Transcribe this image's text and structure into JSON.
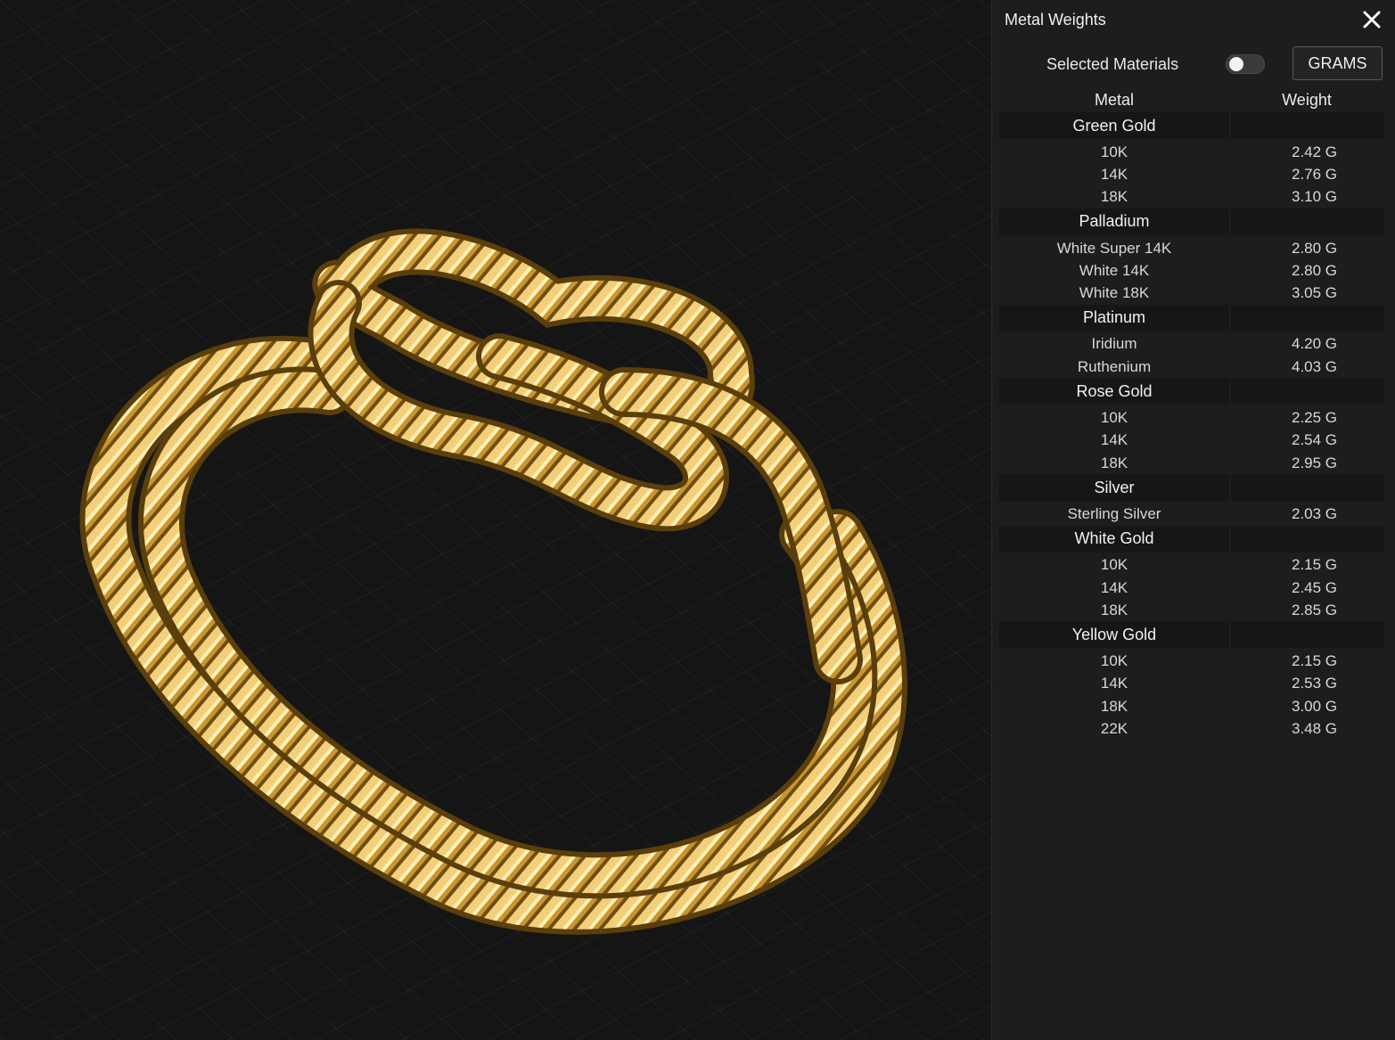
{
  "panel": {
    "title": "Metal Weights",
    "selected_materials_label": "Selected Materials",
    "selected_materials_on": false,
    "unit_button": "GRAMS",
    "columns": {
      "metal": "Metal",
      "weight": "Weight"
    },
    "groups": [
      {
        "name": "Green Gold",
        "items": [
          {
            "name": "10K",
            "weight": "2.42 G"
          },
          {
            "name": "14K",
            "weight": "2.76 G"
          },
          {
            "name": "18K",
            "weight": "3.10 G"
          }
        ]
      },
      {
        "name": "Palladium",
        "items": [
          {
            "name": "White Super 14K",
            "weight": "2.80 G"
          },
          {
            "name": "White 14K",
            "weight": "2.80 G"
          },
          {
            "name": "White 18K",
            "weight": "3.05 G"
          }
        ]
      },
      {
        "name": "Platinum",
        "items": [
          {
            "name": "Iridium",
            "weight": "4.20 G"
          },
          {
            "name": "Ruthenium",
            "weight": "4.03 G"
          }
        ]
      },
      {
        "name": "Rose Gold",
        "items": [
          {
            "name": "10K",
            "weight": "2.25 G"
          },
          {
            "name": "14K",
            "weight": "2.54 G"
          },
          {
            "name": "18K",
            "weight": "2.95 G"
          }
        ]
      },
      {
        "name": "Silver",
        "items": [
          {
            "name": "Sterling Silver",
            "weight": "2.03 G"
          }
        ]
      },
      {
        "name": "White Gold",
        "items": [
          {
            "name": "10K",
            "weight": "2.15 G"
          },
          {
            "name": "14K",
            "weight": "2.45 G"
          },
          {
            "name": "18K",
            "weight": "2.85 G"
          }
        ]
      },
      {
        "name": "Yellow Gold",
        "items": [
          {
            "name": "10K",
            "weight": "2.15 G"
          },
          {
            "name": "14K",
            "weight": "2.53 G"
          },
          {
            "name": "18K",
            "weight": "3.00 G"
          },
          {
            "name": "22K",
            "weight": "3.48 G"
          }
        ]
      }
    ]
  },
  "viewport": {
    "model": "rope-knot-ring",
    "metal_color": "#d9a94a",
    "background_color": "#151515",
    "grid_color": "#2c2c2c"
  }
}
